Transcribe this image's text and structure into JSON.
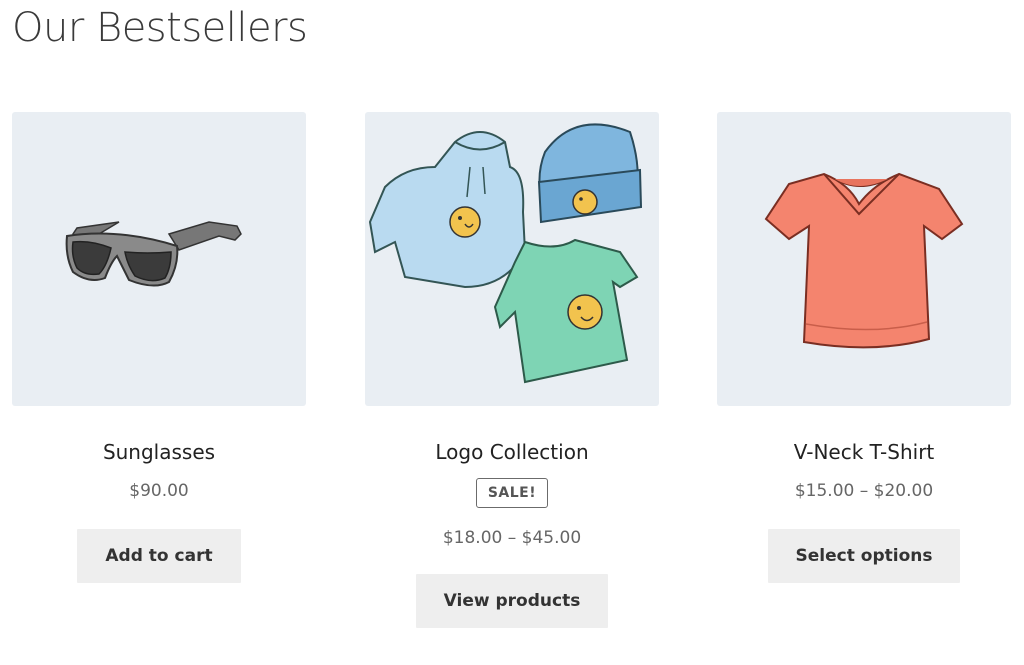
{
  "section": {
    "title": "Our Bestsellers"
  },
  "products": [
    {
      "title": "Sunglasses",
      "price": "$90.00",
      "button": "Add to cart",
      "icon": "sunglasses-image"
    },
    {
      "title": "Logo Collection",
      "badge": "SALE!",
      "price": "$18.00 – $45.00",
      "button": "View products",
      "icon": "logo-collection-image"
    },
    {
      "title": "V-Neck T-Shirt",
      "price": "$15.00 – $20.00",
      "button": "Select options",
      "icon": "vneck-tshirt-image"
    }
  ],
  "colors": {
    "thumb_bg": "#e9eef3",
    "button_bg": "#eeeeee",
    "tshirt": "#f4846e",
    "hoodie": "#b9daf0",
    "beanie": "#7fb6de",
    "green_tee": "#7ed4b4",
    "emoji": "#f2c34e"
  }
}
